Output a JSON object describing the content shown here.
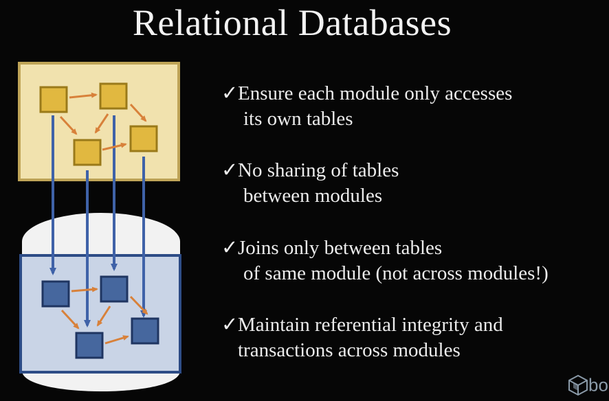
{
  "slide": {
    "title": "Relational Databases"
  },
  "bullets": [
    {
      "check": "✓",
      "line1": "Ensure each module only accesses",
      "line2": "its own tables"
    },
    {
      "check": "✓",
      "line1": "No sharing of tables",
      "line2": "between modules"
    },
    {
      "check": "✓",
      "line1": "Joins only between tables",
      "line2": "of same module (not across modules!)"
    },
    {
      "check": "✓",
      "line1": "Maintain referential integrity and",
      "line2": "transactions across modules"
    }
  ],
  "logo": {
    "text": "bo",
    "icon": "cube-icon"
  },
  "colors": {
    "background": "#060606",
    "module_fill": "#f1e2ae",
    "module_border": "#bfa457",
    "module_box": "#e1b840",
    "module_box_border": "#9a7a1a",
    "db_fill": "#c9d4e6",
    "db_border": "#2d4c86",
    "db_top": "#f2f2f2",
    "db_box": "#46679e",
    "db_box_border": "#1f3561",
    "arrow_orange": "#d8813a",
    "arrow_blue": "#3f62a8"
  }
}
